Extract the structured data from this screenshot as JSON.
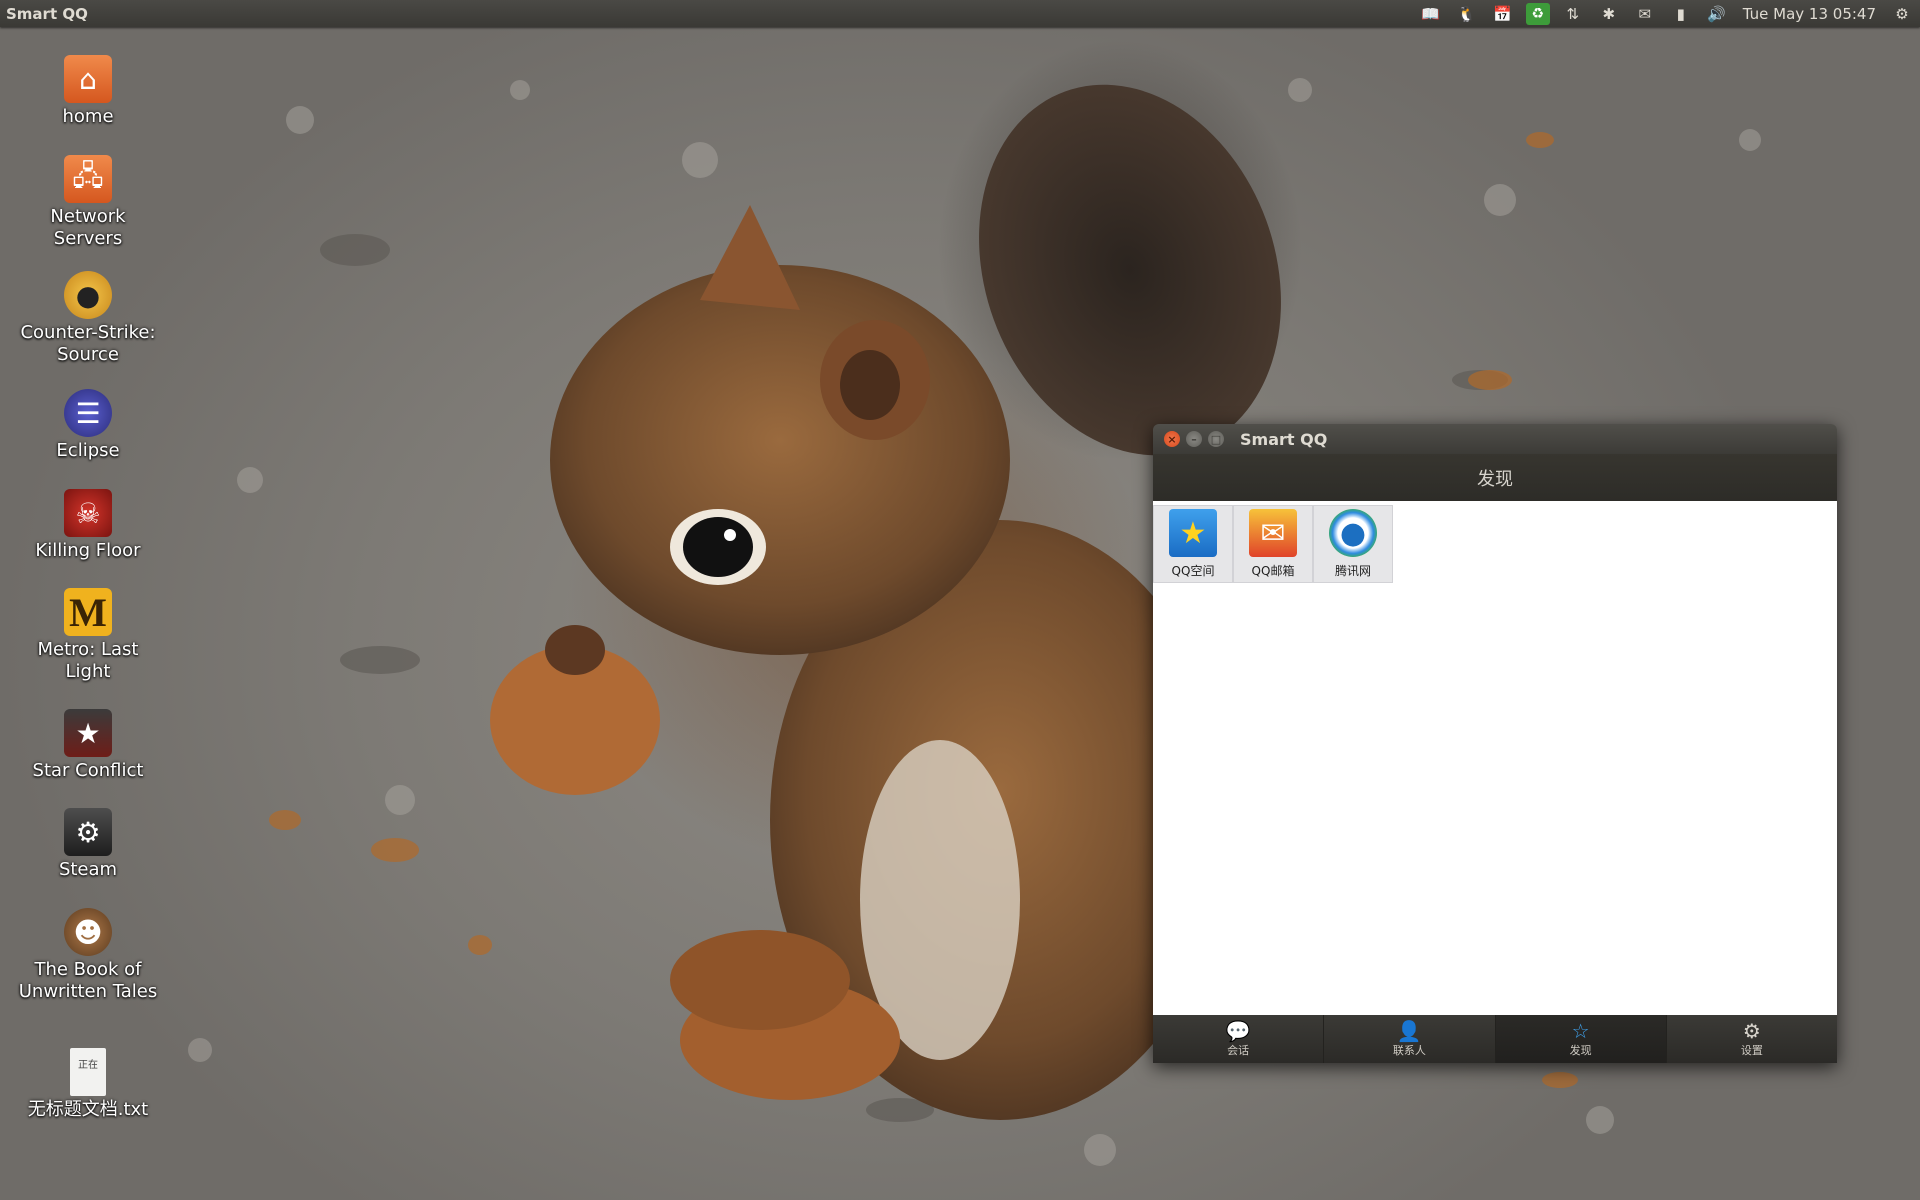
{
  "top_panel": {
    "app_name": "Smart QQ",
    "clock": "Tue May 13 05:47",
    "tray_icons": [
      "book-icon",
      "qq-penguin-icon",
      "calendar-icon",
      "green-recycle-icon",
      "network-arrows-icon",
      "bluetooth-icon",
      "mail-icon",
      "battery-icon",
      "volume-icon",
      "settings-gear-icon"
    ]
  },
  "desktop": {
    "icons": [
      {
        "label": "home",
        "icon": "home-folder-icon"
      },
      {
        "label": "Network Servers",
        "icon": "network-folder-icon"
      },
      {
        "label": "Counter-Strike: Source",
        "icon": "counter-strike-icon"
      },
      {
        "label": "Eclipse",
        "icon": "eclipse-icon"
      },
      {
        "label": "Killing Floor",
        "icon": "killing-floor-icon"
      },
      {
        "label": "Metro: Last Light",
        "icon": "metro-icon"
      },
      {
        "label": "Star Conflict",
        "icon": "star-conflict-icon"
      },
      {
        "label": "Steam",
        "icon": "steam-icon"
      },
      {
        "label": "The Book of Unwritten Tales",
        "icon": "book-of-tales-icon"
      },
      {
        "label": "无标题文档.txt",
        "icon": "text-file-icon",
        "thumb_text": "正在"
      }
    ]
  },
  "window": {
    "title": "Smart QQ",
    "header": "发现",
    "apps": [
      {
        "label": "QQ空间",
        "icon": "qzone-star-icon"
      },
      {
        "label": "QQ邮箱",
        "icon": "qq-mail-icon"
      },
      {
        "label": "腾讯网",
        "icon": "tencent-news-icon"
      }
    ],
    "tabs": [
      {
        "label": "会话",
        "icon": "chat-bubble-icon"
      },
      {
        "label": "联系人",
        "icon": "contact-person-icon"
      },
      {
        "label": "发现",
        "icon": "discover-star-icon"
      },
      {
        "label": "设置",
        "icon": "settings-gear-icon"
      }
    ],
    "active_tab": "发现"
  },
  "colors": {
    "panel": "#3c3b37",
    "close_button": "#e05a2b",
    "active_tab_icon": "#3f9fe8"
  }
}
